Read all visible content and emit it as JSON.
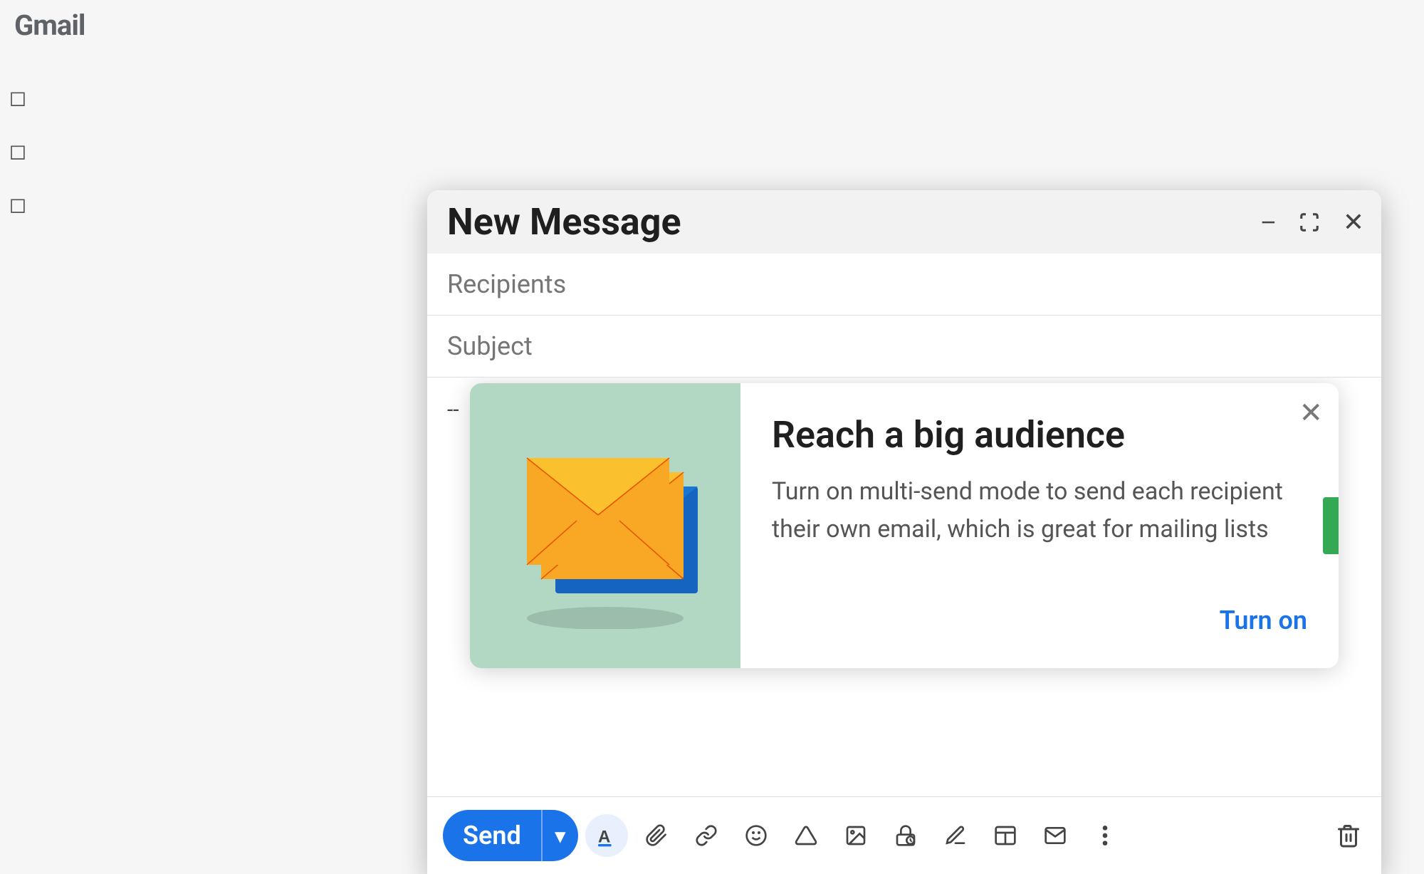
{
  "header": {
    "title": "New Message",
    "minimize_label": "−",
    "expand_label": "⤢",
    "close_label": "✕"
  },
  "fields": {
    "recipients_placeholder": "Recipients",
    "subject_placeholder": "Subject"
  },
  "body": {
    "signature": "--"
  },
  "tooltip": {
    "title": "Reach a big audience",
    "description": "Turn on multi-send mode to send each recipient their own email, which is great for mailing lists",
    "action_label": "Turn on",
    "close_label": "✕"
  },
  "toolbar": {
    "send_label": "Send",
    "send_arrow": "▾",
    "formatting_icon": "A",
    "attach_icon": "📎",
    "link_icon": "🔗",
    "emoji_icon": "☺",
    "drive_icon": "△",
    "image_icon": "▣",
    "lock_icon": "🔒",
    "pen_icon": "✏",
    "template_icon": "⊟",
    "mail_icon": "✉",
    "more_icon": "⋮",
    "delete_icon": "🗑"
  },
  "colors": {
    "send_button": "#1a73e8",
    "turn_on": "#1a73e8",
    "tooltip_image_bg": "#b2d8c4"
  }
}
